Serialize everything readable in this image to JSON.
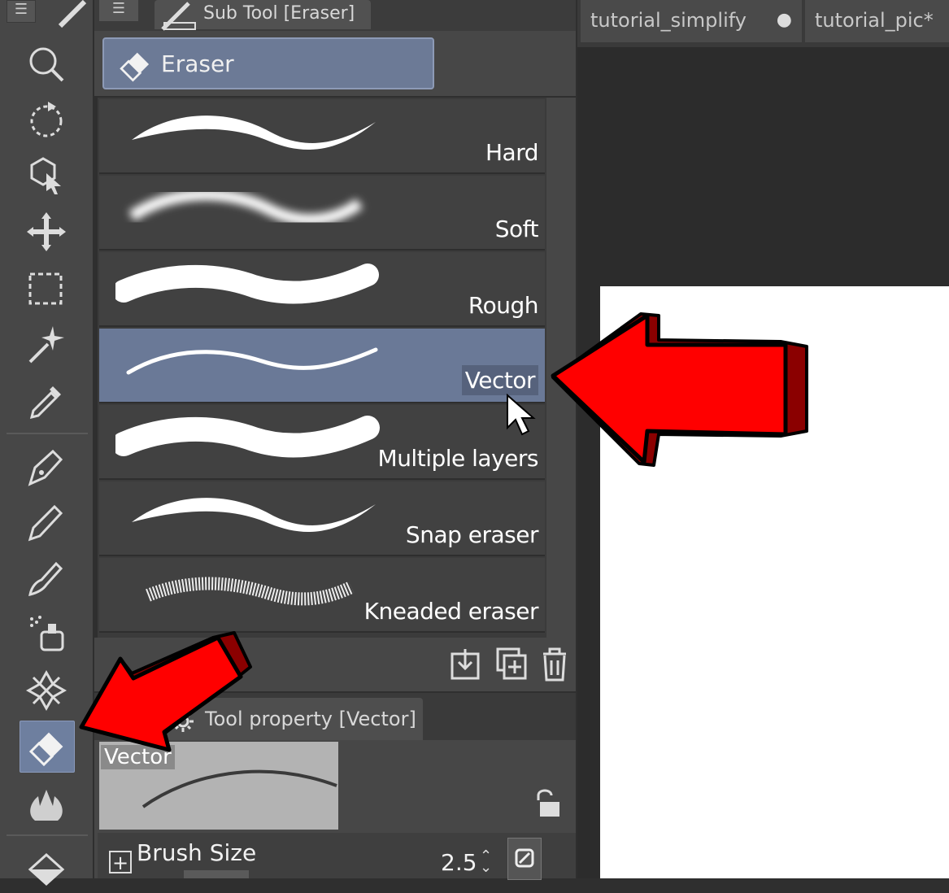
{
  "subtool_panel": {
    "title": "Sub Tool [Eraser]",
    "group_label": "Eraser",
    "items": [
      {
        "name": "Hard",
        "selected": false
      },
      {
        "name": "Soft",
        "selected": false
      },
      {
        "name": "Rough",
        "selected": false
      },
      {
        "name": "Vector",
        "selected": true
      },
      {
        "name": "Multiple layers",
        "selected": false
      },
      {
        "name": "Snap eraser",
        "selected": false
      },
      {
        "name": "Kneaded eraser",
        "selected": false
      }
    ]
  },
  "tool_property": {
    "title": "Tool property [Vector]",
    "preview_label": "Vector",
    "brush_size_label": "Brush Size",
    "brush_size_value": "2.5"
  },
  "document_tabs": [
    {
      "label": "tutorial_simplify"
    },
    {
      "label": "tutorial_pic*"
    }
  ],
  "toolbar": {
    "tools": [
      "menu-icon",
      "zoom-icon",
      "rotate-icon",
      "object-select-icon",
      "move-icon",
      "marquee-select-icon",
      "magic-wand-icon",
      "eyedropper-icon",
      "pen-icon",
      "pencil-icon",
      "brush-icon",
      "airbrush-icon",
      "decoration-icon",
      "eraser-icon",
      "blend-icon",
      "fill-icon"
    ],
    "active_tool": "eraser-icon"
  },
  "colors": {
    "selection": "#6a7997",
    "annotation_arrow": "#ff0000",
    "annotation_arrow_shade": "#8b0000",
    "canvas": "#ffffff"
  }
}
